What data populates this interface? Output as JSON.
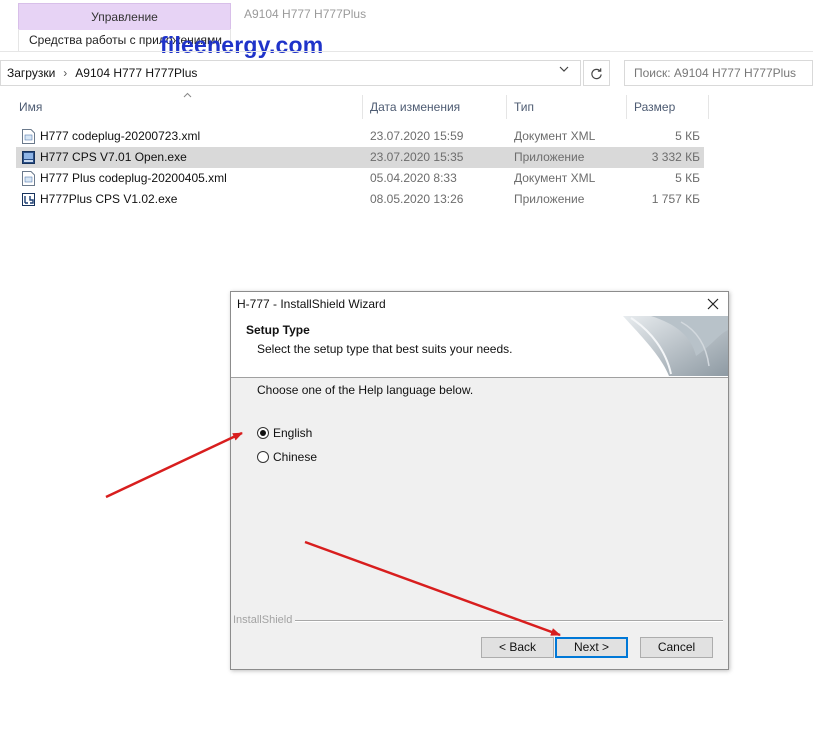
{
  "ribbon": {
    "tab_label": "Управление",
    "sub_label": "Средства работы с приложениями"
  },
  "window": {
    "title": "A9104 H777 H777Plus"
  },
  "watermark": "fileenergy.com",
  "address": {
    "crumb1": "Загрузки",
    "separator": "›",
    "crumb2": "A9104 H777 H777Plus"
  },
  "search": {
    "placeholder": "Поиск: A9104 H777 H777Plus"
  },
  "columns": {
    "name": "Имя",
    "date": "Дата изменения",
    "type": "Тип",
    "size": "Размер"
  },
  "files": [
    {
      "name": "H777 codeplug-20200723.xml",
      "date": "23.07.2020 15:59",
      "type": "Документ XML",
      "size": "5 КБ",
      "icon": "xml-file-icon",
      "selected": false
    },
    {
      "name": "H777 CPS V7.01 Open.exe",
      "date": "23.07.2020 15:35",
      "type": "Приложение",
      "size": "3 332 КБ",
      "icon": "exe-app-icon",
      "selected": true
    },
    {
      "name": "H777 Plus codeplug-20200405.xml",
      "date": "05.04.2020 8:33",
      "type": "Документ XML",
      "size": "5 КБ",
      "icon": "xml-file-icon",
      "selected": false
    },
    {
      "name": "H777Plus CPS V1.02.exe",
      "date": "08.05.2020 13:26",
      "type": "Приложение",
      "size": "1 757 КБ",
      "icon": "exe-app-icon",
      "selected": false
    }
  ],
  "dialog": {
    "title": "H-777 - InstallShield Wizard",
    "heading": "Setup Type",
    "subheading": "Select the setup type that best suits your needs.",
    "prompt": "Choose one of the Help language below.",
    "options": [
      {
        "label": "English",
        "checked": true
      },
      {
        "label": "Chinese",
        "checked": false
      }
    ],
    "footer_brand": "InstallShield",
    "back_label": "< Back",
    "next_label": "Next >",
    "cancel_label": "Cancel"
  },
  "colors": {
    "ribbon_tab": "#e7d3f5",
    "watermark": "#1f33c9",
    "selection": "#d9d9d9",
    "annotation_arrow": "#d81e1e",
    "default_button_border": "#0078d7"
  }
}
